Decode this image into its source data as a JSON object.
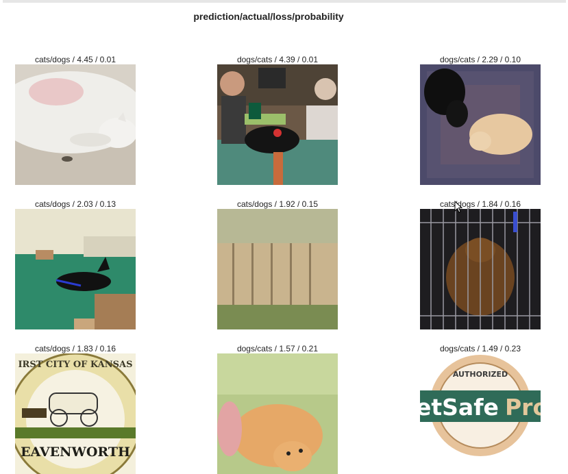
{
  "figure": {
    "title": "prediction/actual/loss/probability"
  },
  "chart_data": {
    "type": "image_grid",
    "title": "prediction/actual/loss/probability",
    "columns": [
      "prediction",
      "actual",
      "loss",
      "probability"
    ],
    "panels": [
      {
        "label": "cats/dogs / 4.45 / 0.01",
        "prediction": "cats",
        "actual": "dogs",
        "loss": 4.45,
        "probability": 0.01
      },
      {
        "label": "dogs/cats / 4.39 / 0.01",
        "prediction": "dogs",
        "actual": "cats",
        "loss": 4.39,
        "probability": 0.01
      },
      {
        "label": "dogs/cats / 2.29 / 0.10",
        "prediction": "dogs",
        "actual": "cats",
        "loss": 2.29,
        "probability": 0.1
      },
      {
        "label": "cats/dogs / 2.03 / 0.13",
        "prediction": "cats",
        "actual": "dogs",
        "loss": 2.03,
        "probability": 0.13
      },
      {
        "label": "cats/dogs / 1.92 / 0.15",
        "prediction": "cats",
        "actual": "dogs",
        "loss": 1.92,
        "probability": 0.15
      },
      {
        "label": "cats/dogs / 1.84 / 0.16",
        "prediction": "cats",
        "actual": "dogs",
        "loss": 1.84,
        "probability": 0.16
      },
      {
        "label": "cats/dogs / 1.83 / 0.16",
        "prediction": "cats",
        "actual": "dogs",
        "loss": 1.83,
        "probability": 0.16
      },
      {
        "label": "dogs/cats / 1.57 / 0.21",
        "prediction": "dogs",
        "actual": "cats",
        "loss": 1.57,
        "probability": 0.21
      },
      {
        "label": "dogs/cats / 1.49 / 0.23",
        "prediction": "dogs",
        "actual": "cats",
        "loss": 1.49,
        "probability": 0.23
      }
    ]
  },
  "images": {
    "seal_top_text": "IRST CITY OF KANSAS",
    "seal_bottom_text": "EAVENWORTH",
    "logo_top_text": "AUTHORIZED",
    "logo_main_text": "etSafe",
    "logo_side_text": "Pro"
  }
}
